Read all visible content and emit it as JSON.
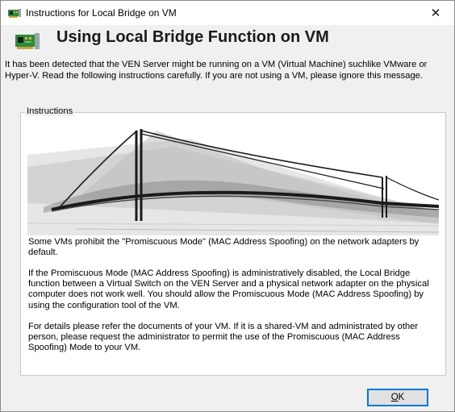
{
  "window": {
    "title": "Instructions for Local Bridge on VM",
    "close_glyph": "✕",
    "title_icon": "network-adapter-icon"
  },
  "header": {
    "icon": "network-adapter-icon",
    "title": "Using Local Bridge Function on VM"
  },
  "intro": "It has been detected that the VEN Server might be running on a VM (Virtual Machine) suchlike VMware or Hyper-V. Read the following instructions carefully. If you are not using a VM, please ignore this message.",
  "instructions": {
    "label": "Instructions",
    "image": "bridge-illustration",
    "paragraphs": [
      "Some VMs prohibit the \"Promiscuous Mode\" (MAC Address Spoofing) on the network adapters by default.",
      "If the Promiscuous Mode (MAC Address Spoofing) is administratively disabled, the Local Bridge function between a Virtual Switch on the VEN Server and a physical network adapter on the physical computer does not work well. You should allow the Promiscuous Mode (MAC Address Spoofing) by using the configuration tool of the VM.",
      "For details please refer the documents of your VM. If it is a shared-VM and administrated by other person, please request the administrator to permit the use of the Promiscuous (MAC Address Spoofing) Mode to your VM."
    ]
  },
  "buttons": {
    "ok_mnemonic": "O",
    "ok_rest": "K"
  },
  "colors": {
    "accent": "#0078d7",
    "adapter_green": "#2e8b3a"
  }
}
